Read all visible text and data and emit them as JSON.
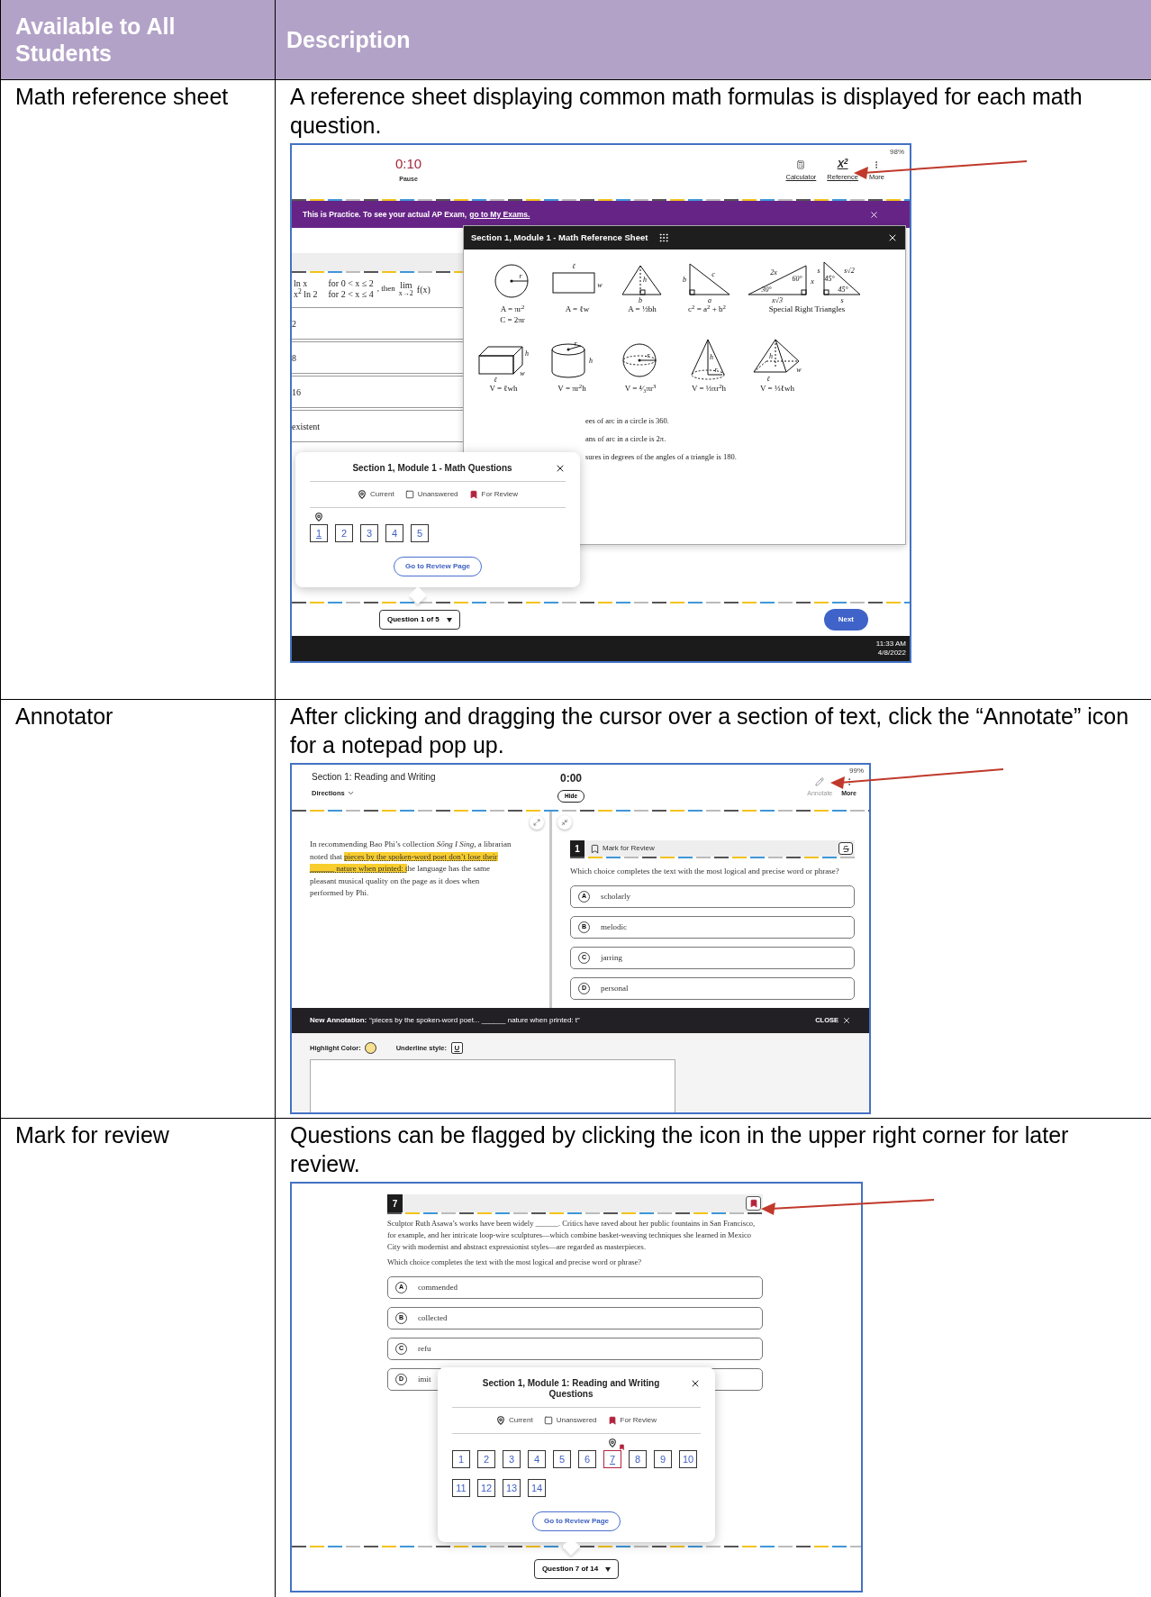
{
  "table": {
    "columns": [
      "Available to All Students",
      "Description"
    ],
    "rows": [
      {
        "feature": "Math reference sheet",
        "description": "A reference sheet displaying common math formulas is displayed for each math question.",
        "screenshot": {
          "kind": "reference",
          "battery": "98%",
          "timer": "0:10",
          "pause": "Pause",
          "tools": [
            {
              "kind": "calculator",
              "label": "Calculator"
            },
            {
              "kind": "glyph",
              "glyph": "X$^{2}$",
              "label": "Reference"
            },
            {
              "kind": "more",
              "label": "More"
            }
          ],
          "banner": {
            "text": "This is Practice. To see your actual AP Exam,",
            "link": "go to My Exams."
          },
          "function_lines": [
            "ln x",
            "for 0 < x ≤ 2",
            "x$^{2}$ ln 2",
            "for 2 < x ≤ 4"
          ],
          "limit": {
            "lead": ", then",
            "op": "lim",
            "under": "x→2",
            "arg": "f(x)"
          },
          "answers": [
            "2",
            "8",
            "16",
            "existent"
          ],
          "sheet": {
            "title": "Section 1, Module 1 - Math Reference Sheet",
            "shapes": [
              {
                "kind": "circle",
                "labels": [
                  "r"
                ],
                "formulas": [
                  "A = πr$^{2}$",
                  "C = 2πr"
                ]
              },
              {
                "kind": "rectangle",
                "labels": [
                  "ℓ",
                  "w"
                ],
                "formulas": [
                  "A = ℓw"
                ]
              },
              {
                "kind": "triangle",
                "labels": [
                  "h",
                  "b"
                ],
                "formulas": [
                  "A = ½bh"
                ]
              },
              {
                "kind": "right-triangle",
                "labels": [
                  "b",
                  "c",
                  "a"
                ],
                "formulas": [
                  "c$^{2}$ = a$^{2}$ + b$^{2}$"
                ]
              },
              {
                "kind": "special",
                "labels": [
                  "2x",
                  "60°",
                  "x",
                  "30°",
                  "x√3",
                  "s",
                  "45°",
                  "s√2",
                  "45°",
                  "s"
                ],
                "formulas": [
                  "Special Right Triangles"
                ]
              }
            ],
            "solids": [
              {
                "kind": "box",
                "labels": [
                  "h",
                  "w",
                  "ℓ"
                ],
                "formulas": [
                  "V = ℓwh"
                ]
              },
              {
                "kind": "cylinder",
                "labels": [
                  "r",
                  "h"
                ],
                "formulas": [
                  "V = πr$^{2}$h"
                ]
              },
              {
                "kind": "sphere",
                "labels": [
                  "r"
                ],
                "formulas": [
                  "V = ⁴⁄₃πr$^{3}$"
                ]
              },
              {
                "kind": "cone",
                "labels": [
                  "h",
                  "r"
                ],
                "formulas": [
                  "V = ⅓πr$^{2}$h"
                ]
              },
              {
                "kind": "pyramid",
                "labels": [
                  "h",
                  "w",
                  "ℓ"
                ],
                "formulas": [
                  "V = ⅓ℓwh"
                ]
              }
            ],
            "facts": [
              "ees of arc in a circle is 360.",
              "ans of arc in a circle is 2π.",
              "sures in degrees of the angles of a triangle is 180."
            ]
          },
          "navigator": {
            "title": "Section 1, Module 1 - Math Questions",
            "legend": [
              {
                "kind": "current",
                "label": "Current"
              },
              {
                "kind": "unanswered",
                "label": "Unanswered"
              },
              {
                "kind": "review",
                "label": "For Review"
              }
            ],
            "questions": [
              {
                "label": "1",
                "current": true,
                "review": false
              },
              {
                "label": "2",
                "current": false,
                "review": false
              },
              {
                "label": "3",
                "current": false,
                "review": false
              },
              {
                "label": "4",
                "current": false,
                "review": false
              },
              {
                "label": "5",
                "current": false,
                "review": false
              }
            ],
            "review_button": "Go to Review Page"
          },
          "question_select": "Question 1 of 5",
          "next": "Next",
          "time": "11:33 AM",
          "date": "4/8/2022"
        }
      },
      {
        "feature": "Annotator",
        "description": "After clicking and dragging the cursor over a section of text, click the “Annotate” icon for a notepad pop up.",
        "screenshot": {
          "kind": "annotator",
          "section": "Section 1: Reading and Writing",
          "directions": "Directions",
          "timer": "0:00",
          "hide": "Hide",
          "battery": "99%",
          "tools": [
            {
              "kind": "pen",
              "label": "Annotate",
              "disabled": true
            },
            {
              "kind": "more",
              "label": "More",
              "disabled": false
            }
          ],
          "passage": [
            {
              "text": "In recommending Bao Phi’s collection *Sống I Sing*, a librarian noted that ",
              "highlighted": false
            },
            {
              "text": "pieces by the spoken-word poet don’t lose their ______ nature when printed: t",
              "highlighted": true
            },
            {
              "text": "he language has the same pleasant musical quality on the page as it does when performed by Phi.",
              "highlighted": false
            }
          ],
          "question": {
            "number": "1",
            "mark": "Mark for Review",
            "marked": false,
            "prompt": "Which choice completes the text with the most logical and precise word or phrase?",
            "choices": [
              {
                "letter": "A",
                "text": "scholarly"
              },
              {
                "letter": "B",
                "text": "melodic"
              },
              {
                "letter": "C",
                "text": "jarring"
              },
              {
                "letter": "D",
                "text": "personal"
              }
            ]
          },
          "annotation": {
            "label": "New Annotation:",
            "quote": "“pieces by the spoken-word poet... ______ nature when printed: t”",
            "close": "CLOSE",
            "highlight_label": "Highlight Color:",
            "underline_label": "Underline style:",
            "underline_glyph": "U"
          }
        }
      },
      {
        "feature": "Mark for review",
        "description": "Questions can be flagged by clicking the icon in the upper right corner for later review.",
        "screenshot": {
          "kind": "review",
          "question": {
            "number": "7",
            "marked": true,
            "passage": "Sculptor Ruth Asawa’s works have been widely ______. Critics have raved about her public fountains in San Francisco, for example, and her intricate loop-wire sculptures—which combine basket-weaving techniques she learned in Mexico City with modernist and abstract expressionist styles—are regarded as masterpieces.",
            "prompt": "Which choice completes the text with the most logical and precise word or phrase?",
            "choices": [
              {
                "letter": "A",
                "text": "commended"
              },
              {
                "letter": "B",
                "text": "collected"
              },
              {
                "letter": "C",
                "text": "refu"
              },
              {
                "letter": "D",
                "text": "imit"
              }
            ]
          },
          "navigator": {
            "title": "Section 1, Module 1: Reading and Writing Questions",
            "legend": [
              {
                "kind": "current",
                "label": "Current"
              },
              {
                "kind": "unanswered",
                "label": "Unanswered"
              },
              {
                "kind": "review",
                "label": "For Review"
              }
            ],
            "questions": [
              {
                "label": "1",
                "current": false,
                "review": false
              },
              {
                "label": "2",
                "current": false,
                "review": false
              },
              {
                "label": "3",
                "current": false,
                "review": false
              },
              {
                "label": "4",
                "current": false,
                "review": false
              },
              {
                "label": "5",
                "current": false,
                "review": false
              },
              {
                "label": "6",
                "current": false,
                "review": false
              },
              {
                "label": "7",
                "current": true,
                "review": true
              },
              {
                "label": "8",
                "current": false,
                "review": false
              },
              {
                "label": "9",
                "current": false,
                "review": false
              },
              {
                "label": "10",
                "current": false,
                "review": false
              },
              {
                "label": "11",
                "current": false,
                "review": false
              },
              {
                "label": "12",
                "current": false,
                "review": false
              },
              {
                "label": "13",
                "current": false,
                "review": false
              },
              {
                "label": "14",
                "current": false,
                "review": false
              }
            ],
            "review_button": "Go to Review Page"
          },
          "question_select": "Question 7 of 14"
        }
      }
    ]
  }
}
